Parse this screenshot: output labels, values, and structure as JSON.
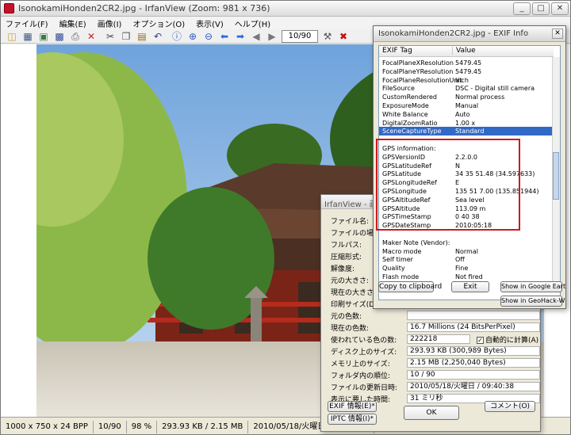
{
  "app": {
    "title": "IsonokamiHonden2CR2.jpg - IrfanView (Zoom: 981 x 736)",
    "window_buttons": [
      "_",
      "□",
      "✕"
    ]
  },
  "menu": [
    "ファイル(F)",
    "編集(E)",
    "画像(I)",
    "オプション(O)",
    "表示(V)",
    "ヘルプ(H)"
  ],
  "toolbar": {
    "page_value": "10/90",
    "icons": [
      "open-folder",
      "thumbnails",
      "slideshow",
      "save",
      "print",
      "delete",
      "cut",
      "copy",
      "paste",
      "undo",
      "info",
      "zoom-in",
      "zoom-out",
      "prev",
      "next",
      "first",
      "last",
      "settings",
      "exit"
    ]
  },
  "status": {
    "resolution": "1000 x 750 x 24 BPP",
    "page": "10/90",
    "zoom": "98 %",
    "size": "293.93 KB / 2.15 MB",
    "date": "2010/05/18/火曜日 / 09:40:38"
  },
  "info": {
    "title": "IrfanView - 画像情報",
    "rows": [
      {
        "label": "ファイル名:",
        "value": ""
      },
      {
        "label": "ファイルの場所:",
        "value": ""
      },
      {
        "label": "フルパス:",
        "value": ""
      },
      {
        "label": "圧縮形式:",
        "value": ""
      },
      {
        "label": "解像度:",
        "value": ""
      },
      {
        "label": "元の大きさ:",
        "value": ""
      },
      {
        "label": "現在の大きさ:",
        "value": ""
      },
      {
        "label": "印刷サイズ(DPI):",
        "value": ""
      },
      {
        "label": "元の色数:",
        "value": ""
      },
      {
        "label": "現在の色数:",
        "value": "16.7 Millions  (24 BitsPerPixel)"
      },
      {
        "label": "使われている色の数:",
        "value": "222218"
      },
      {
        "label": "ディスク上のサイズ:",
        "value": "293.93 KB (300,989 Bytes)"
      },
      {
        "label": "メモリ上のサイズ:",
        "value": "2.15  MB (2,250,040 Bytes)"
      },
      {
        "label": "フォルダ内の順位:",
        "value": "10 / 90"
      },
      {
        "label": "ファイルの更新日時:",
        "value": "2010/05/18/火曜日 / 09:40:38"
      },
      {
        "label": "表示に要した時間:",
        "value": "31 ミリ秒"
      }
    ],
    "auto_calc": "自動的に計算(A)",
    "exif_button": "EXIF 情報(E)*",
    "iptc_button": "IPTC 情報(I)*",
    "ok_button": "OK",
    "comment_button": "コメント(O)"
  },
  "exif": {
    "title": "IsonokamiHonden2CR2.jpg - EXIF Info",
    "header": {
      "tag": "EXIF Tag",
      "value": "Value"
    },
    "rows": [
      {
        "tag": "FocalPlaneXResolution",
        "value": "5479.45"
      },
      {
        "tag": "FocalPlaneYResolution",
        "value": "5479.45"
      },
      {
        "tag": "FocalPlaneResolutionUnit",
        "value": "Inch"
      },
      {
        "tag": "FileSource",
        "value": "DSC - Digital still camera"
      },
      {
        "tag": "CustomRendered",
        "value": "Normal process"
      },
      {
        "tag": "ExposureMode",
        "value": "Manual"
      },
      {
        "tag": "White Balance",
        "value": "Auto"
      },
      {
        "tag": "DigitalZoomRatio",
        "value": "1.00 x"
      },
      {
        "tag": "SceneCaptureType",
        "value": "Standard"
      },
      {
        "tag": "",
        "value": ""
      },
      {
        "tag": "GPS information:",
        "value": ""
      },
      {
        "tag": "GPSVersionID",
        "value": "2.2.0.0"
      },
      {
        "tag": "GPSLatitudeRef",
        "value": "N"
      },
      {
        "tag": "GPSLatitude",
        "value": "34  35  51.48 (34.597633)"
      },
      {
        "tag": "GPSLongitudeRef",
        "value": "E"
      },
      {
        "tag": "GPSLongitude",
        "value": "135  51  7.00 (135.851944)"
      },
      {
        "tag": "GPSAltitudeRef",
        "value": "Sea level"
      },
      {
        "tag": "GPSAltitude",
        "value": "113.09 m"
      },
      {
        "tag": "GPSTimeStamp",
        "value": "0  40  38"
      },
      {
        "tag": "GPSDateStamp",
        "value": "2010:05:18"
      },
      {
        "tag": "",
        "value": ""
      },
      {
        "tag": "Maker Note (Vendor):",
        "value": ""
      },
      {
        "tag": "Macro mode",
        "value": "Normal"
      },
      {
        "tag": "Self timer",
        "value": "Off"
      },
      {
        "tag": "Quality",
        "value": "Fine"
      },
      {
        "tag": "Flash mode",
        "value": "Not fired"
      }
    ],
    "selected_index": 8,
    "copy_button": "Copy to clipboard",
    "exit_button": "Exit",
    "google_button": "Show in Google Earth",
    "geohack_button": "Show in GeoHack-Wiki"
  },
  "colors": {
    "selection": "#3169c6",
    "highlight_box": "#d01818"
  }
}
